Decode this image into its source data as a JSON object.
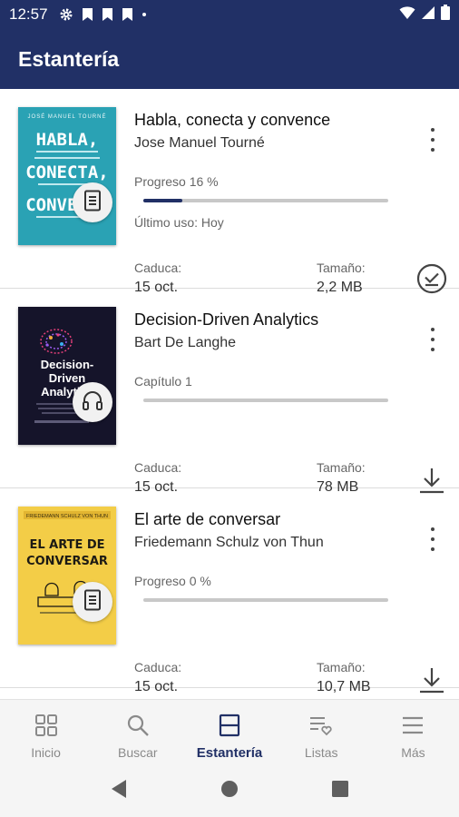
{
  "status_bar": {
    "time": "12:57"
  },
  "app_bar": {
    "title": "Estantería"
  },
  "labels": {
    "expires": "Caduca:",
    "size": "Tamaño:"
  },
  "books": [
    {
      "title": "Habla, conecta y convence",
      "author": "Jose Manuel Tourné",
      "progress_label": "Progreso 16 %",
      "progress": 0.16,
      "last_used": "Último uso: Hoy",
      "expires": "15 oct.",
      "size": "2,2 MB",
      "format_icon": "ebook-icon",
      "action_icon": "downloaded-check-icon",
      "cover": {
        "top": "JOSÉ MANUEL TOURNÉ",
        "lines": [
          "HABLA,",
          "CONECTA,",
          "CONVENCE"
        ],
        "color": "#2aa2b4"
      }
    },
    {
      "title": "Decision-Driven Analytics",
      "author": "Bart De Langhe",
      "progress_label": "Capítulo 1",
      "progress": 0,
      "expires": "15 oct.",
      "size": "78 MB",
      "format_icon": "headphones-icon",
      "action_icon": "download-icon",
      "cover": {
        "lines": [
          "Decision-",
          "Driven",
          "Analytics"
        ],
        "color": "#15142a"
      }
    },
    {
      "title": "El arte de conversar",
      "author": "Friedemann Schulz von Thun",
      "progress_label": "Progreso 0 %",
      "progress": 0,
      "expires": "15 oct.",
      "size": "10,7 MB",
      "format_icon": "ebook-icon",
      "action_icon": "download-icon",
      "cover": {
        "top": "FRIEDEMANN SCHULZ VON THUN",
        "lines": [
          "EL ARTE DE",
          "CONVERSAR"
        ],
        "color": "#f3cd47"
      }
    }
  ],
  "bottom_nav": [
    {
      "label": "Inicio",
      "icon": "grid-icon",
      "active": false
    },
    {
      "label": "Buscar",
      "icon": "search-icon",
      "active": false
    },
    {
      "label": "Estantería",
      "icon": "shelf-icon",
      "active": true
    },
    {
      "label": "Listas",
      "icon": "list-heart-icon",
      "active": false
    },
    {
      "label": "Más",
      "icon": "menu-icon",
      "active": false
    }
  ],
  "colors": {
    "primary": "#213066",
    "progress_track": "#c8c8c8"
  }
}
